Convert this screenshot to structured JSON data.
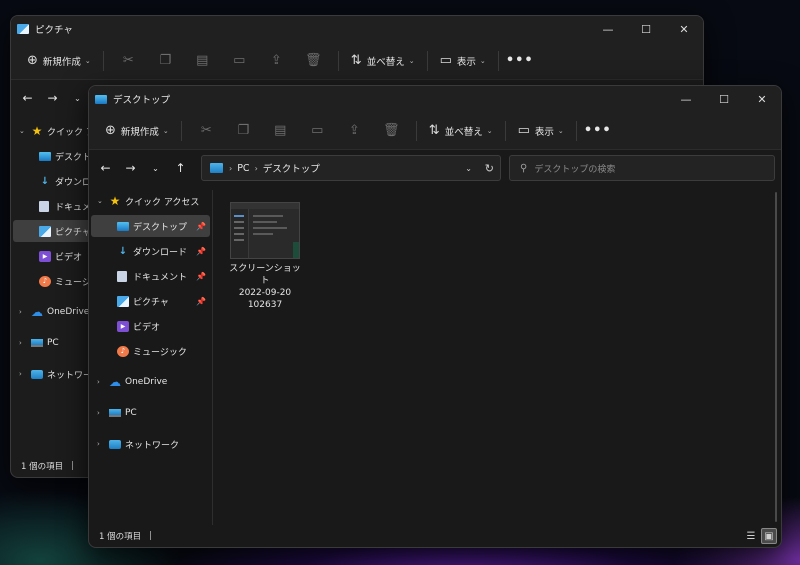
{
  "back_window": {
    "title": "ピクチャ",
    "toolbar": {
      "new_label": "新規作成",
      "sort_label": "並べ替え",
      "view_label": "表示"
    },
    "sidebar": [
      {
        "label": "クイック アクセス",
        "icon": "star-icon",
        "chevron": "v"
      },
      {
        "label": "デスクトップ",
        "icon": "desktop-folder-icon"
      },
      {
        "label": "ダウンロード",
        "icon": "download-icon"
      },
      {
        "label": "ドキュメント",
        "icon": "document-icon"
      },
      {
        "label": "ピクチャ",
        "icon": "pictures-icon",
        "selected": true
      },
      {
        "label": "ビデオ",
        "icon": "video-icon"
      },
      {
        "label": "ミュージック",
        "icon": "music-icon"
      },
      {
        "label": "OneDrive",
        "icon": "onedrive-cloud-icon",
        "chevron": ">"
      },
      {
        "label": "PC",
        "icon": "pc-icon",
        "chevron": ">"
      },
      {
        "label": "ネットワーク",
        "icon": "network-icon",
        "chevron": ">"
      }
    ],
    "status": "1 個の項目"
  },
  "front_window": {
    "title": "デスクトップ",
    "toolbar": {
      "new_label": "新規作成",
      "sort_label": "並べ替え",
      "view_label": "表示"
    },
    "address": {
      "parts": [
        "PC",
        "デスクトップ"
      ]
    },
    "search": {
      "placeholder": "デスクトップの検索"
    },
    "sidebar": [
      {
        "label": "クイック アクセス",
        "icon": "star-icon",
        "chevron": "v"
      },
      {
        "label": "デスクトップ",
        "icon": "desktop-folder-icon",
        "pinned": true,
        "selected": true
      },
      {
        "label": "ダウンロード",
        "icon": "download-icon",
        "pinned": true
      },
      {
        "label": "ドキュメント",
        "icon": "document-icon",
        "pinned": true
      },
      {
        "label": "ピクチャ",
        "icon": "pictures-icon",
        "pinned": true
      },
      {
        "label": "ビデオ",
        "icon": "video-icon"
      },
      {
        "label": "ミュージック",
        "icon": "music-icon"
      },
      {
        "label": "OneDrive",
        "icon": "onedrive-cloud-icon",
        "chevron": ">"
      },
      {
        "label": "PC",
        "icon": "pc-icon",
        "chevron": ">"
      },
      {
        "label": "ネットワーク",
        "icon": "network-icon",
        "chevron": ">"
      }
    ],
    "files": [
      {
        "name_lines": [
          "スクリーンショット",
          "2022-09-20",
          "102637"
        ],
        "icon": "screenshot-thumbnail"
      }
    ],
    "status": "1 個の項目"
  },
  "colors": {
    "window_bg": "#191919",
    "accent_folder": "#1f7fc5",
    "selected_row": "#3f3f3f"
  }
}
